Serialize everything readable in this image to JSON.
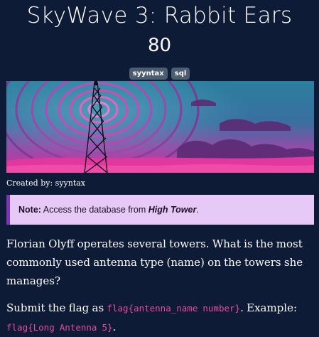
{
  "challenge": {
    "title": "SkyWave 3: Rabbit Ears",
    "points": "80",
    "tags": [
      "syyntax",
      "sql"
    ]
  },
  "created_by": "Created by: syyntax",
  "note": {
    "label": "Note:",
    "text_before": " Access the database from ",
    "emphasis": "High Tower",
    "text_after": "."
  },
  "question": "Florian Olyff operates several towers. What is the most commonly used antenna type (name) on the towers she manages?",
  "submit": {
    "text_before": "Submit the flag as ",
    "format_code": "flag{antenna_name number}",
    "text_middle": ". Example: ",
    "example_code": "flag{Long Antenna 5}",
    "text_after": "."
  },
  "colors": {
    "background": "#0d1b36",
    "note_background": "#e7c9f7",
    "note_border": "#7a34b5",
    "code": "#e44ca7",
    "tag_background": "#4c5d72"
  },
  "icons": {
    "banner": "radio-tower-illustration"
  }
}
